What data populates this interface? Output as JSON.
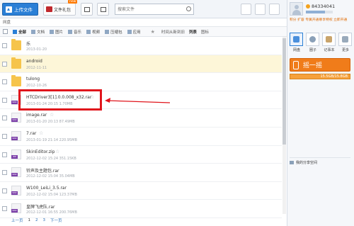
{
  "toolbar": {
    "upload_label": "上传文件",
    "gift_label": "文件礼包",
    "new_badge": "new",
    "search_placeholder": "搜索文件"
  },
  "breadcrumb": "网盘",
  "filters": {
    "all": "全部",
    "doc": "文档",
    "image": "图片",
    "music": "音乐",
    "video": "视频",
    "archive": "压缩包",
    "app": "应用",
    "sort": "时间从新到旧",
    "list_view": "列表",
    "icon_view": "图标"
  },
  "files": [
    {
      "name": "乐",
      "meta": "2013-01-20",
      "type": "folder"
    },
    {
      "name": "android",
      "meta": "2012-11-11",
      "type": "folder"
    },
    {
      "name": "tulong",
      "meta": "2012-10-26",
      "type": "folder"
    },
    {
      "name": "HTCDriver3[1].0.0.008_x32.rar",
      "meta": "2013-01-24 20:15   1.70MB",
      "type": "rar"
    },
    {
      "name": "image.rar",
      "meta": "2013-01-20 20:13   87.49MB",
      "type": "rar"
    },
    {
      "name": "7.rar",
      "meta": "2013-01-19 21:14   220.95MB",
      "type": "rar"
    },
    {
      "name": "SkinEditor.zip",
      "meta": "2012-12-02 15:24   351.15KB",
      "type": "zip"
    },
    {
      "name": "铃声及主题包.rar",
      "meta": "2012-12-02 15:04   35.04MB",
      "type": "rar"
    },
    {
      "name": "W100_LeiLi_3.5.rar",
      "meta": "2012-12-02 15:04   123.37MB",
      "type": "rar"
    },
    {
      "name": "皇牌飞虎队.rar",
      "meta": "2012-12-01 16:55   200.76MB",
      "type": "rar"
    }
  ],
  "pager": {
    "prev": "上一页",
    "p1": "1",
    "p2": "2",
    "p3": "3",
    "next": "下一页"
  },
  "panel": {
    "user_id": "84334041",
    "promo": "积分 扩容 专属开通尊享特权 立即开通",
    "apps": [
      {
        "label": "网盘"
      },
      {
        "label": "圈子"
      },
      {
        "label": "记事本"
      },
      {
        "label": "更多"
      }
    ],
    "shake_label": "摇一摇",
    "quota": "15.5GB/15.8GB",
    "share_label": "我的分享空间"
  },
  "colors": {
    "accent": "#2a7fd6",
    "highlight_box": "#e0151c",
    "shake": "#f07c1a"
  }
}
